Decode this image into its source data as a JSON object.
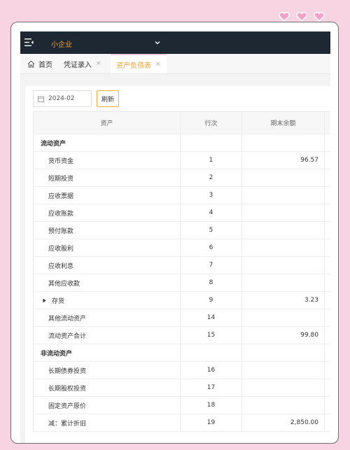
{
  "header": {
    "company": "小企业"
  },
  "tabs": [
    {
      "label": "首页"
    },
    {
      "label": "凭证录入",
      "close": "×"
    },
    {
      "label": "资产负债表",
      "close": "×"
    }
  ],
  "toolbar": {
    "period": "2024-02",
    "refresh_label": "刷新"
  },
  "table": {
    "columns": [
      "资产",
      "行次",
      "期末余额"
    ],
    "rows": [
      {
        "name": "流动资产",
        "line": "",
        "amount": ""
      },
      {
        "name": "货币资金",
        "line": "1",
        "amount": "96.57"
      },
      {
        "name": "短期投资",
        "line": "2",
        "amount": ""
      },
      {
        "name": "应收票据",
        "line": "3",
        "amount": ""
      },
      {
        "name": "应收账款",
        "line": "4",
        "amount": ""
      },
      {
        "name": "预付账款",
        "line": "5",
        "amount": ""
      },
      {
        "name": "应收股利",
        "line": "6",
        "amount": ""
      },
      {
        "name": "应收利息",
        "line": "7",
        "amount": ""
      },
      {
        "name": "其他应收款",
        "line": "8",
        "amount": ""
      },
      {
        "name": "存货",
        "line": "9",
        "amount": "3.23"
      },
      {
        "name": "其他流动资产",
        "line": "14",
        "amount": ""
      },
      {
        "name": "流动资产合计",
        "line": "15",
        "amount": "99.80"
      },
      {
        "name": "非流动资产",
        "line": "",
        "amount": ""
      },
      {
        "name": "长期债券投资",
        "line": "16",
        "amount": ""
      },
      {
        "name": "长期股权投资",
        "line": "17",
        "amount": ""
      },
      {
        "name": "固定资产原价",
        "line": "18",
        "amount": ""
      },
      {
        "name": "减：累计折旧",
        "line": "19",
        "amount": "2,850.00"
      }
    ]
  },
  "colors": {
    "background": "#f8d3e1",
    "topbar": "#1e2833",
    "accent": "#f0a030",
    "heart": "#f4a3c6"
  }
}
